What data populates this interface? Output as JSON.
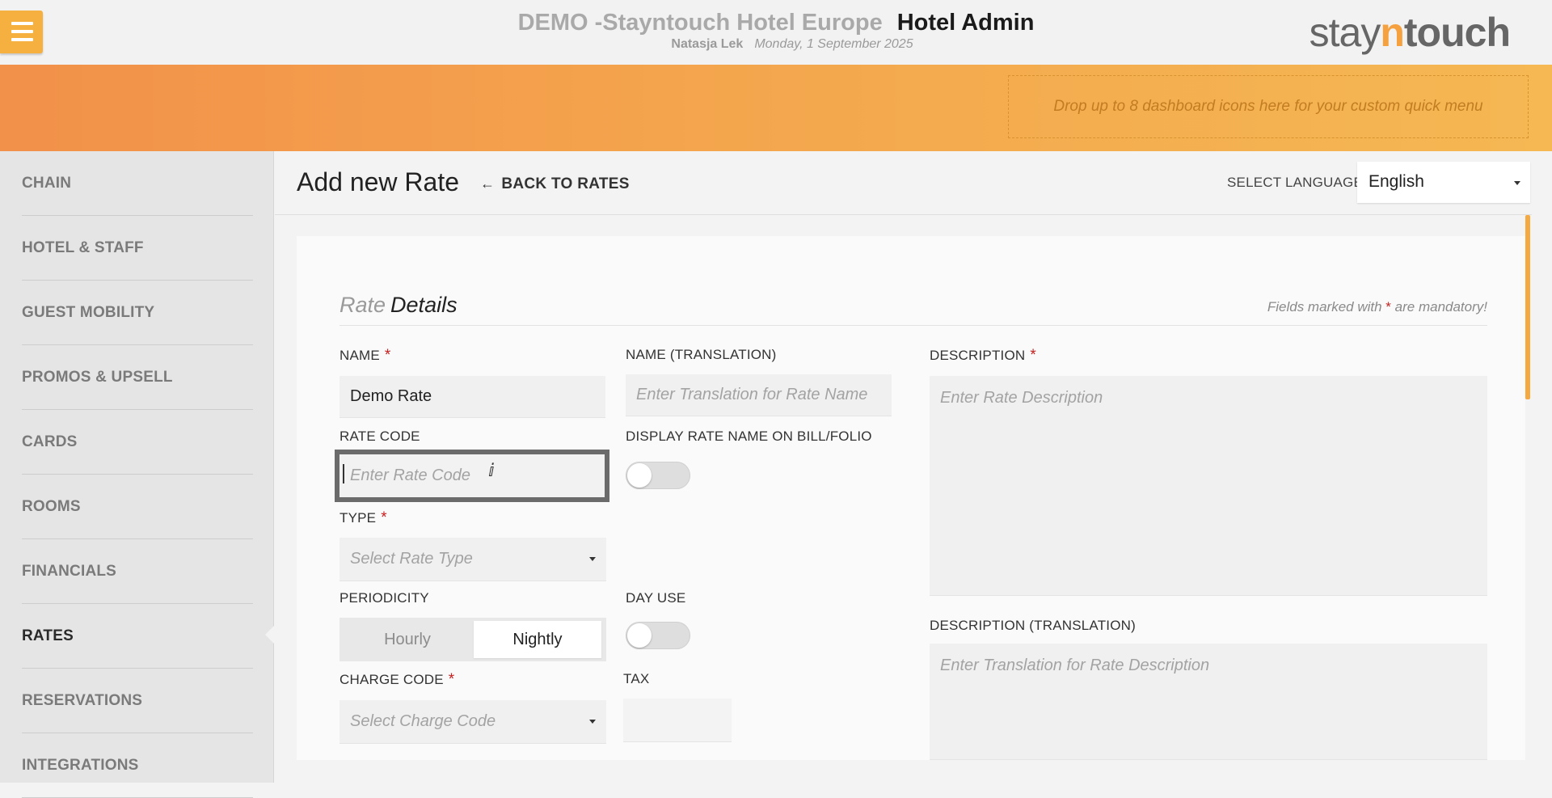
{
  "header": {
    "hotel_name": "DEMO -Stayntouch Hotel Europe",
    "app_title": "Hotel Admin",
    "user": "Natasja Lek",
    "date": "Monday, 1 September 2025",
    "logo": {
      "part1": "stay",
      "part2": "n",
      "part3": "touch"
    },
    "menu_icon": "hamburger-icon"
  },
  "quick_menu": {
    "drop_text": "Drop up to 8 dashboard icons here for your custom quick menu"
  },
  "sidebar": {
    "items": [
      {
        "label": "CHAIN"
      },
      {
        "label": "HOTEL & STAFF"
      },
      {
        "label": "GUEST MOBILITY"
      },
      {
        "label": "PROMOS & UPSELL"
      },
      {
        "label": "CARDS"
      },
      {
        "label": "ROOMS"
      },
      {
        "label": "FINANCIALS"
      },
      {
        "label": "RATES",
        "active": true
      },
      {
        "label": "RESERVATIONS"
      },
      {
        "label": "INTEGRATIONS"
      }
    ]
  },
  "page": {
    "title": "Add new Rate",
    "back_label": "BACK TO RATES",
    "language_label": "SELECT LANGUAGE",
    "language_value": "English"
  },
  "form": {
    "section_title_light": "Rate",
    "section_title_dark": "Details",
    "mandatory_prefix": "Fields marked with",
    "mandatory_star": "*",
    "mandatory_suffix": "are mandatory!",
    "name_label": "NAME",
    "name_value": "Demo Rate",
    "name_translation_label": "NAME (TRANSLATION)",
    "name_translation_placeholder": "Enter Translation for Rate Name",
    "rate_code_label": "RATE CODE",
    "rate_code_placeholder": "Enter Rate Code",
    "display_name_label": "DISPLAY RATE NAME ON BILL/FOLIO",
    "display_name_on": false,
    "type_label": "TYPE",
    "type_placeholder": "Select Rate Type",
    "periodicity_label": "PERIODICITY",
    "periodicity_options": [
      "Hourly",
      "Nightly"
    ],
    "periodicity_selected": "Nightly",
    "day_use_label": "DAY USE",
    "day_use_on": false,
    "charge_code_label": "CHARGE CODE",
    "charge_code_placeholder": "Select Charge Code",
    "tax_label": "TAX",
    "description_label": "DESCRIPTION",
    "description_placeholder": "Enter Rate Description",
    "description_translation_label": "DESCRIPTION (TRANSLATION)",
    "description_translation_placeholder": "Enter Translation for Rate Description",
    "required_star": "*"
  },
  "colors": {
    "accent": "#f5a941",
    "required": "#c81e1e",
    "band_start": "#f2914a",
    "band_end": "#f5b853"
  }
}
